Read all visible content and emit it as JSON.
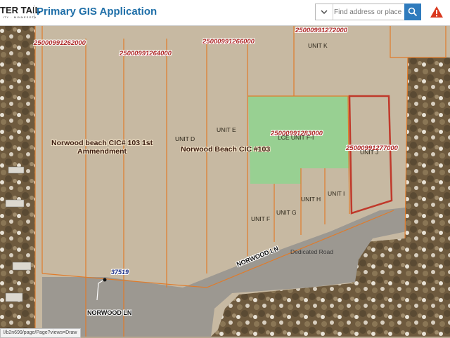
{
  "header": {
    "logo_text": "TER TAIL",
    "logo_subtext": "ITY · MINNESOTA",
    "title": "Primary GIS Application"
  },
  "search": {
    "placeholder": "Find address or place",
    "dropdown_icon": "chevron-down-icon",
    "button_icon": "search-icon"
  },
  "alert_icon": "warning-icon",
  "colors": {
    "brand_title": "#1f6fa8",
    "search_button": "#2f7bbd",
    "warning": "#d9381e",
    "parcel_line": "#e07b2a",
    "parcel_label": "#b02a2a",
    "highlight_fill": "#8fd48f",
    "selected_outline": "#c0392b"
  },
  "map": {
    "parcel_ids": [
      "25000991262000",
      "25000991264000",
      "25000991266000",
      "25000991272000",
      "25000991283000",
      "25000991277000"
    ],
    "subdivisions": [
      {
        "line1": "Norwood beach CIC# 103 1st",
        "line2": "Ammendment"
      },
      {
        "line1": "Norwood Beach CIC #103",
        "line2": ""
      }
    ],
    "units": [
      "UNIT K",
      "UNIT D",
      "UNIT E",
      "LCE UNIT F-I",
      "UNIT J",
      "UNIT I",
      "UNIT H",
      "UNIT G",
      "UNIT F"
    ],
    "roads": {
      "upper": "NORWOOD LN",
      "lower": "NORWOOD LN",
      "dedicated": "Dedicated Road"
    },
    "address_point": "37519"
  },
  "status_bar": {
    "url_text": "l/b2n699/page/Page?views=Draw"
  }
}
